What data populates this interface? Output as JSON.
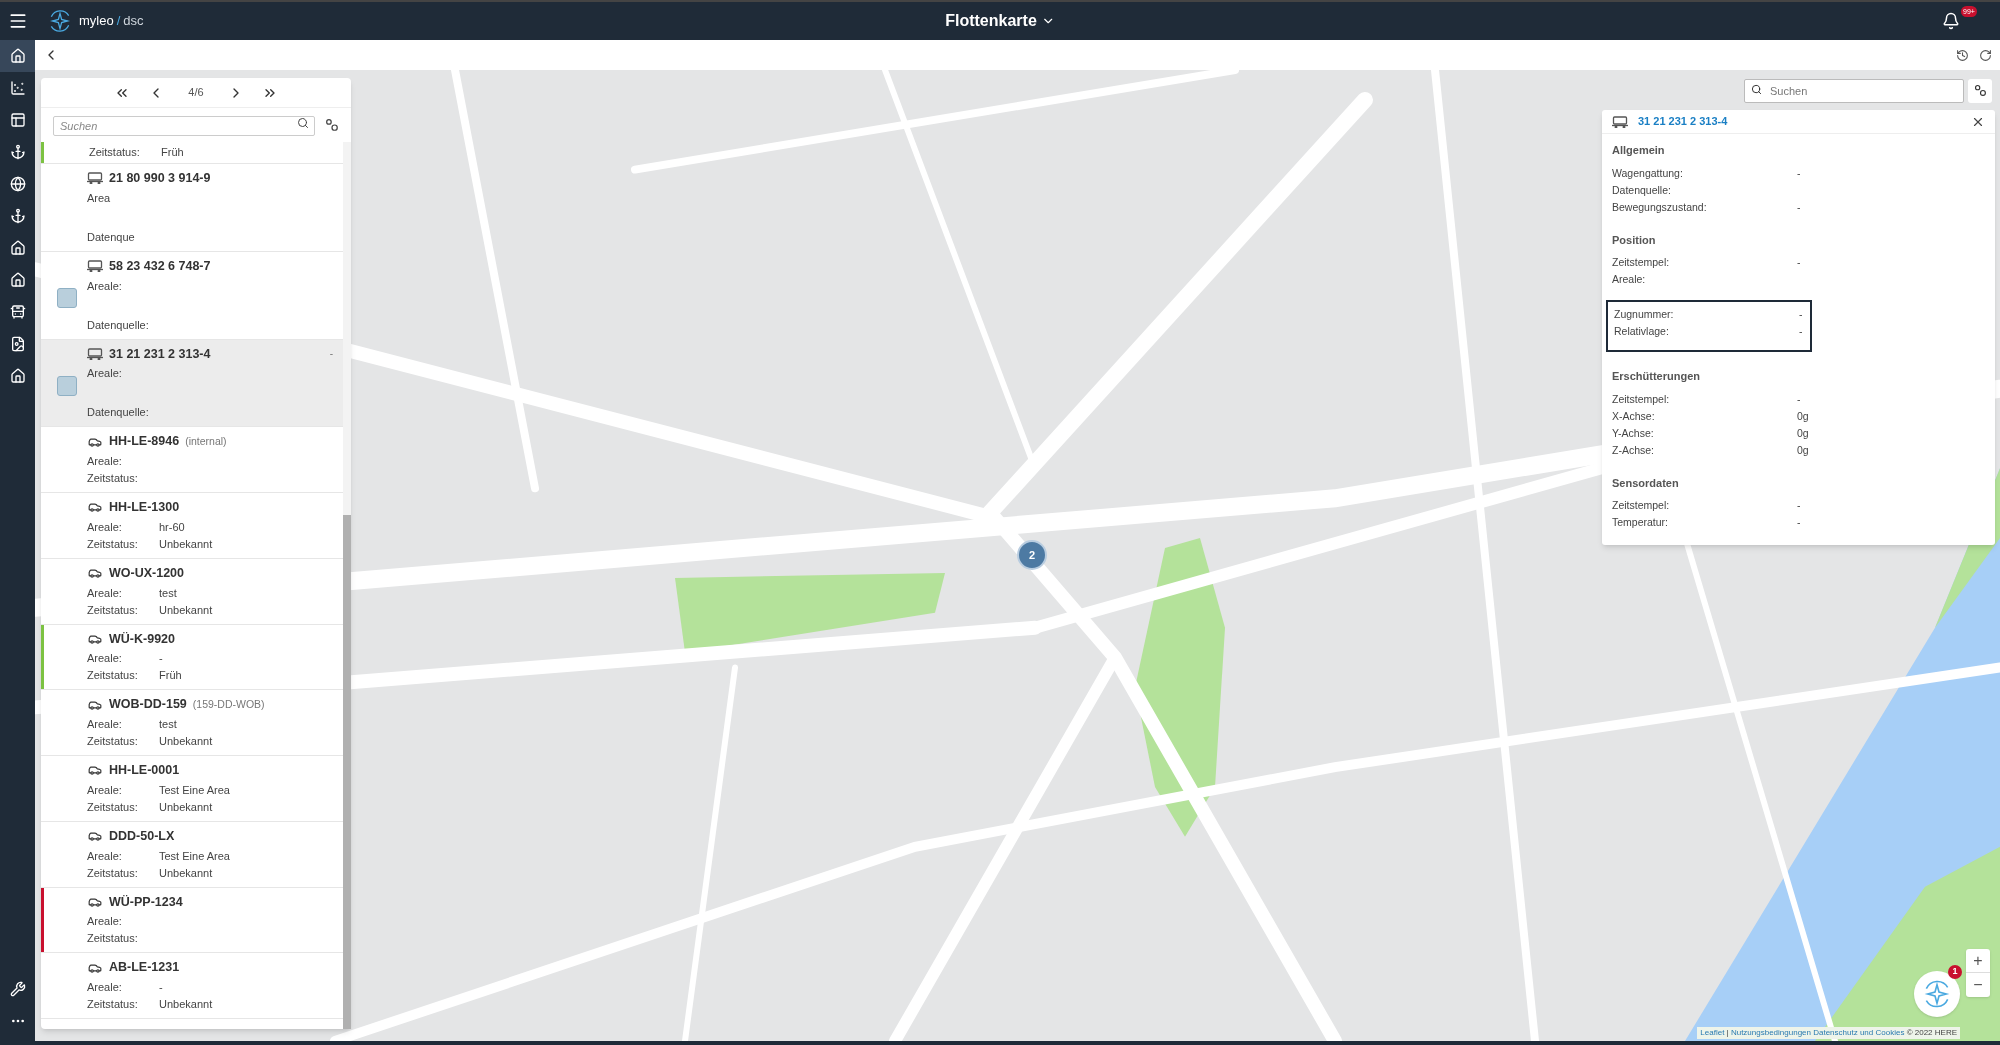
{
  "app": {
    "logo_text": "myleo",
    "logo_separator": "/",
    "logo_suffix": "dsc",
    "title": "Flottenkarte",
    "notifications": "99+"
  },
  "nav": [
    {
      "selected": true
    },
    {
      "selected": false
    },
    {
      "selected": false
    },
    {
      "selected": false
    },
    {
      "selected": false
    },
    {
      "selected": false
    },
    {
      "selected": false
    },
    {
      "selected": false
    },
    {
      "selected": false
    },
    {
      "selected": false
    },
    {
      "selected": false
    }
  ],
  "list_panel": {
    "page": "4/6",
    "search": {
      "placeholder": "Suchen"
    },
    "items": [
      {
        "kind": "partial",
        "selected": false,
        "color": "#7cc242",
        "fields": [
          {
            "label": "Zeitstatus:",
            "value": "Früh"
          }
        ]
      },
      {
        "kind": "wagon",
        "title": "21 80 990 3 914-9",
        "selected": false,
        "thumbnail": false,
        "fields": [
          {
            "label": "Area"
          },
          {
            "label": "Datenque"
          }
        ]
      },
      {
        "kind": "wagon",
        "title": "58 23 432 6 748-7",
        "selected": false,
        "thumbnail": true,
        "fields": [
          {
            "label": "Areale:"
          },
          {
            "label": "Datenquelle:"
          }
        ]
      },
      {
        "kind": "wagon",
        "title": "31 21 231 2 313-4",
        "selected": true,
        "thumbnail": true,
        "extra": "-",
        "fields": [
          {
            "label": "Areale:"
          },
          {
            "label": "Datenquelle:"
          }
        ]
      },
      {
        "kind": "car",
        "title": "HH-LE-8946",
        "subtitle": "(internal)",
        "selected": false,
        "fields": [
          {
            "label": "Areale:"
          },
          {
            "label": "Zeitstatus:"
          }
        ]
      },
      {
        "kind": "car",
        "title": "HH-LE-1300",
        "selected": false,
        "fields": [
          {
            "label": "Areale:",
            "value": "hr-60"
          },
          {
            "label": "Zeitstatus:",
            "value": "Unbekannt"
          }
        ]
      },
      {
        "kind": "car",
        "title": "WO-UX-1200",
        "selected": false,
        "fields": [
          {
            "label": "Areale:",
            "value": "test"
          },
          {
            "label": "Zeitstatus:",
            "value": "Unbekannt"
          }
        ]
      },
      {
        "kind": "car",
        "title": "WÜ-K-9920",
        "selected": false,
        "color": "#7cc242",
        "fields": [
          {
            "label": "Areale:",
            "value": "-"
          },
          {
            "label": "Zeitstatus:",
            "value": "Früh"
          }
        ]
      },
      {
        "kind": "car",
        "title": "WOB-DD-159",
        "subtitle": "(159-DD-WOB)",
        "selected": false,
        "fields": [
          {
            "label": "Areale:",
            "value": "test"
          },
          {
            "label": "Zeitstatus:",
            "value": "Unbekannt"
          }
        ]
      },
      {
        "kind": "car",
        "title": "HH-LE-0001",
        "selected": false,
        "fields": [
          {
            "label": "Areale:",
            "value": "Test Eine Area"
          },
          {
            "label": "Zeitstatus:",
            "value": "Unbekannt"
          }
        ]
      },
      {
        "kind": "car",
        "title": "DDD-50-LX",
        "selected": false,
        "fields": [
          {
            "label": "Areale:",
            "value": "Test Eine Area"
          },
          {
            "label": "Zeitstatus:",
            "value": "Unbekannt"
          }
        ]
      },
      {
        "kind": "car",
        "title": "WÜ-PP-1234",
        "selected": false,
        "color": "#c8102e",
        "fields": [
          {
            "label": "Areale:"
          },
          {
            "label": "Zeitstatus:"
          }
        ]
      },
      {
        "kind": "car",
        "title": "AB-LE-1231",
        "selected": false,
        "fields": [
          {
            "label": "Areale:",
            "value": "-"
          },
          {
            "label": "Zeitstatus:",
            "value": "Unbekannt"
          }
        ]
      }
    ]
  },
  "map": {
    "search": {
      "placeholder": "Suchen"
    },
    "cluster": "2",
    "assistant_badge": "1",
    "zoom_in": "+",
    "zoom_out": "−",
    "attribution": {
      "links": [
        "Leaflet",
        "Nutzungsbedingungen",
        "Datenschutz und Cookies"
      ],
      "separator": "|",
      "copyright": "© 2022 HERE"
    }
  },
  "detail_panel": {
    "title": "31 21 231 2 313-4",
    "sections": [
      {
        "title": "Allgemein",
        "outlined": false,
        "rows": [
          {
            "label": "Wagengattung:",
            "value": "-"
          },
          {
            "label": "Datenquelle:"
          },
          {
            "label": "Bewegungszustand:",
            "value": "-"
          }
        ]
      },
      {
        "title": "Position",
        "outlined": false,
        "rows": [
          {
            "label": "Zeitstempel:",
            "value": "-"
          },
          {
            "label": "Areale:"
          }
        ]
      },
      {
        "outlined": true,
        "rows": [
          {
            "label": "Zugnummer:",
            "value": "-"
          },
          {
            "label": "Relativlage:",
            "value": "-"
          }
        ]
      },
      {
        "title": "Erschütterungen",
        "outlined": false,
        "rows": [
          {
            "label": "Zeitstempel:",
            "value": "-"
          },
          {
            "label": "X-Achse:",
            "value": "0g"
          },
          {
            "label": "Y-Achse:",
            "value": "0g"
          },
          {
            "label": "Z-Achse:",
            "value": "0g"
          }
        ]
      },
      {
        "title": "Sensordaten",
        "outlined": false,
        "rows": [
          {
            "label": "Zeitstempel:",
            "value": "-"
          },
          {
            "label": "Temperatur:",
            "value": "-"
          }
        ]
      }
    ]
  }
}
